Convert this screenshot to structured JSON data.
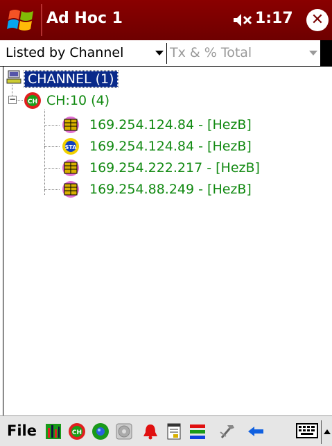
{
  "titlebar": {
    "title": "Ad Hoc 1",
    "time": "1:17",
    "close_glyph": "✕",
    "start_icon": "windows-flag-icon",
    "volume_icon": "speaker-muted-icon",
    "bar_color": "#7a0000"
  },
  "combos": {
    "view": {
      "value": "Listed by Channel"
    },
    "metric": {
      "value": "Tx & % Total"
    }
  },
  "tree": {
    "root": {
      "label": "CHANNEL (1)",
      "icon": "network-icon"
    },
    "channel": {
      "label": "CH:10 (4)",
      "icon": "channel-icon",
      "expander": "−"
    },
    "nodes": [
      {
        "label": "169.254.124.84 - [HezB]",
        "icon": "adhoc-node-icon"
      },
      {
        "label": "169.254.124.84 - [HezB]",
        "icon": "station-icon"
      },
      {
        "label": "169.254.222.217 - [HezB]",
        "icon": "adhoc-node-icon"
      },
      {
        "label": "169.254.88.249 - [HezB]",
        "icon": "adhoc-node-icon"
      }
    ],
    "text_color": "#128a12",
    "selection_color": "#0a2a8a"
  },
  "toolbar": {
    "file_label": "File",
    "icons": [
      "bar-chart-icon",
      "channel-icon",
      "globe-icon",
      "disk-icon",
      "bell-icon",
      "notepad-icon",
      "color-bars-icon",
      "tools-icon",
      "back-arrow-icon",
      "keyboard-icon"
    ]
  }
}
